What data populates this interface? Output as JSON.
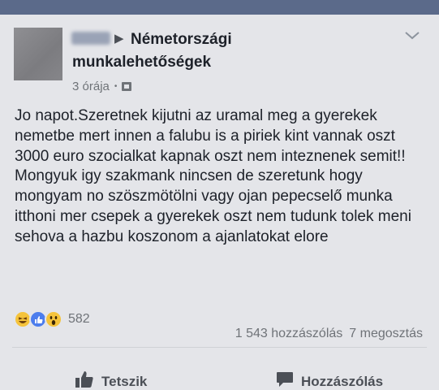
{
  "post": {
    "group_name": "Németországi munkalehetőségek",
    "time": "3 órája",
    "text": "Jo napot.Szeretnek kijutni az uramal meg a gyerekek nemetbe mert innen a falubu is a piriek kint vannak oszt 3000 euro szocialkat kapnak oszt nem inteznenek semit!!\nMongyuk igy szakmank nincsen de szeretunk hogy mongyam no szöszmötölni vagy ojan pepecselő munka itthoni mer csepek a gyerekek oszt nem tudunk tolek meni sehova a hazbu koszonom a ajanlatokat elore"
  },
  "reactions": {
    "count": "582",
    "comments": "1 543 hozzászólás",
    "shares": "7 megosztás",
    "types": [
      "haha-icon",
      "like-icon",
      "wow-icon"
    ]
  },
  "actions": {
    "like_label": "Tetszik",
    "comment_label": "Hozzászólás"
  },
  "colors": {
    "background": "#e4e5e9",
    "text": "#1d2129",
    "muted": "#6f7378",
    "like_blue": "#4c7ded",
    "emoji_yellow": "#f5c33b"
  }
}
